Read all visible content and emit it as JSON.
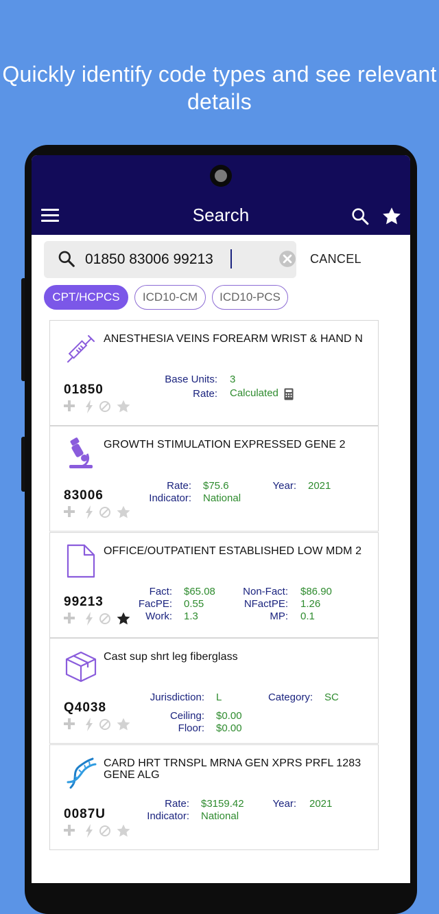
{
  "headline": "Quickly identify code types and see relevant details",
  "appbar": {
    "title": "Search"
  },
  "search": {
    "value": "01850 83006 99213",
    "cancel_label": "CANCEL"
  },
  "chips": [
    "CPT/HCPCS",
    "ICD10-CM",
    "ICD10-PCS"
  ],
  "results": [
    {
      "icon": "syringe-icon",
      "description": "ANESTHESIA VEINS FOREARM WRIST & HAND N",
      "code": "01850",
      "favorite": false,
      "fields": [
        {
          "label": "Base Units:",
          "value": "3"
        },
        {
          "label": "Rate:",
          "value": "Calculated"
        }
      ]
    },
    {
      "icon": "microscope-icon",
      "description": "GROWTH STIMULATION EXPRESSED GENE 2",
      "code": "83006",
      "favorite": false,
      "fields": [
        {
          "label": "Rate:",
          "value": "$75.6"
        },
        {
          "label": "Indicator:",
          "value": "National"
        },
        {
          "label": "Year:",
          "value": "2021"
        }
      ]
    },
    {
      "icon": "document-icon",
      "description": "OFFICE/OUTPATIENT ESTABLISHED LOW MDM 2",
      "code": "99213",
      "favorite": true,
      "fields": [
        {
          "label": "Fact:",
          "value": "$65.08"
        },
        {
          "label": "FacPE:",
          "value": "0.55"
        },
        {
          "label": "Work:",
          "value": "1.3"
        },
        {
          "label": "Non-Fact:",
          "value": "$86.90"
        },
        {
          "label": "NFactPE:",
          "value": "1.26"
        },
        {
          "label": "MP:",
          "value": "0.1"
        }
      ]
    },
    {
      "icon": "box-icon",
      "description": "Cast sup shrt leg fiberglass",
      "code": "Q4038",
      "favorite": false,
      "fields": [
        {
          "label": "Jurisdiction:",
          "value": "L"
        },
        {
          "label": "Category:",
          "value": "SC"
        },
        {
          "label": "Ceiling:",
          "value": "$0.00"
        },
        {
          "label": "Floor:",
          "value": "$0.00"
        }
      ]
    },
    {
      "icon": "dna-icon",
      "description": "CARD HRT TRNSPL MRNA GEN XPRS PRFL 1283 GENE ALG",
      "code": "0087U",
      "favorite": false,
      "fields": [
        {
          "label": "Rate:",
          "value": "$3159.42"
        },
        {
          "label": "Indicator:",
          "value": "National"
        },
        {
          "label": "Year:",
          "value": "2021"
        }
      ]
    }
  ],
  "colors": {
    "background": "#5b94e6",
    "appbar": "#120b59",
    "accent": "#7b57e8",
    "label": "#1a237e",
    "value": "#2e8b2e"
  }
}
